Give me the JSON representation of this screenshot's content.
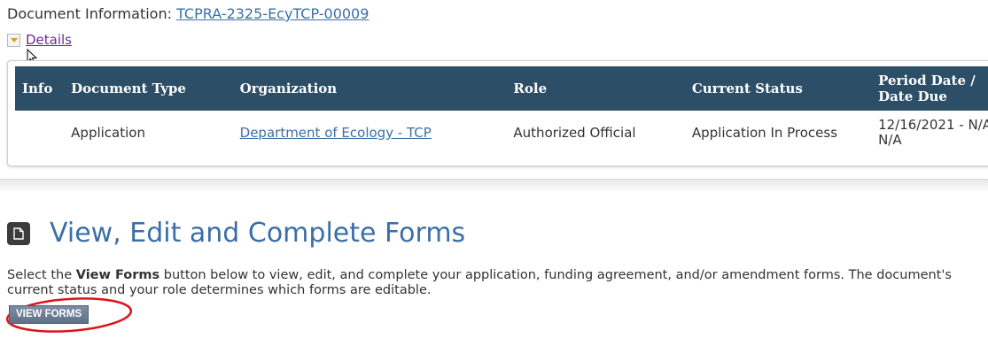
{
  "document_info": {
    "label": "Document Information:",
    "id_link": "TCPRA-2325-EcyTCP-00009"
  },
  "details": {
    "label": "Details"
  },
  "table": {
    "headers": [
      "Info",
      "Document Type",
      "Organization",
      "Role",
      "Current Status",
      "Period Date / Date Due"
    ],
    "row": {
      "info": "",
      "document_type": "Application",
      "organization": "Department of Ecology - TCP",
      "role": "Authorized Official",
      "current_status": "Application In Process",
      "period_date": "12/16/2021 - N/A N/A"
    }
  },
  "forms_section": {
    "icon": "document-icon",
    "title": "View, Edit and Complete Forms",
    "desc_prefix": "Select the ",
    "desc_bold": "View Forms",
    "desc_suffix": " button below to view, edit, and complete your application, funding agreement, and/or amendment forms. The document's current status and your role determines which forms are editable.",
    "button_label": "VIEW FORMS"
  },
  "colors": {
    "header_bg": "#2c4e66",
    "link": "#3a6fa8",
    "highlight": "#d9151b"
  }
}
